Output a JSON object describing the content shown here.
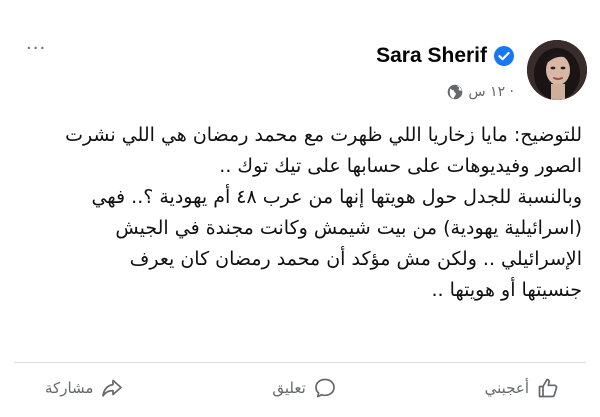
{
  "post": {
    "author": {
      "name": "Sara Sherif",
      "verified": true,
      "avatar_icon": "profile-photo"
    },
    "timestamp": "١٢ س ·",
    "privacy_icon": "globe-icon",
    "more_label": "···",
    "lines": [
      "للتوضيح: مايا زخاريا اللي ظهرت مع محمد رمضان هي اللي نشرت",
      "الصور وفيديوهات على حسابها على تيك توك ..",
      "وبالنسبة للجدل حول هويتها إنها من عرب ٤٨ أم يهودية ؟.. فهي",
      "(اسرائيلية يهودية) من بيت شيمش وكانت مجندة في الجيش",
      "الإسرائيلي .. ولكن مش مؤكد أن محمد رمضان كان يعرف",
      "جنسيتها أو هويتها .."
    ]
  },
  "actions": {
    "like_label": "أعجبني",
    "comment_label": "تعليق",
    "share_label": "مشاركة"
  },
  "colors": {
    "verified_blue": "#1877f2",
    "meta_gray": "#65676b",
    "text": "#050505"
  }
}
